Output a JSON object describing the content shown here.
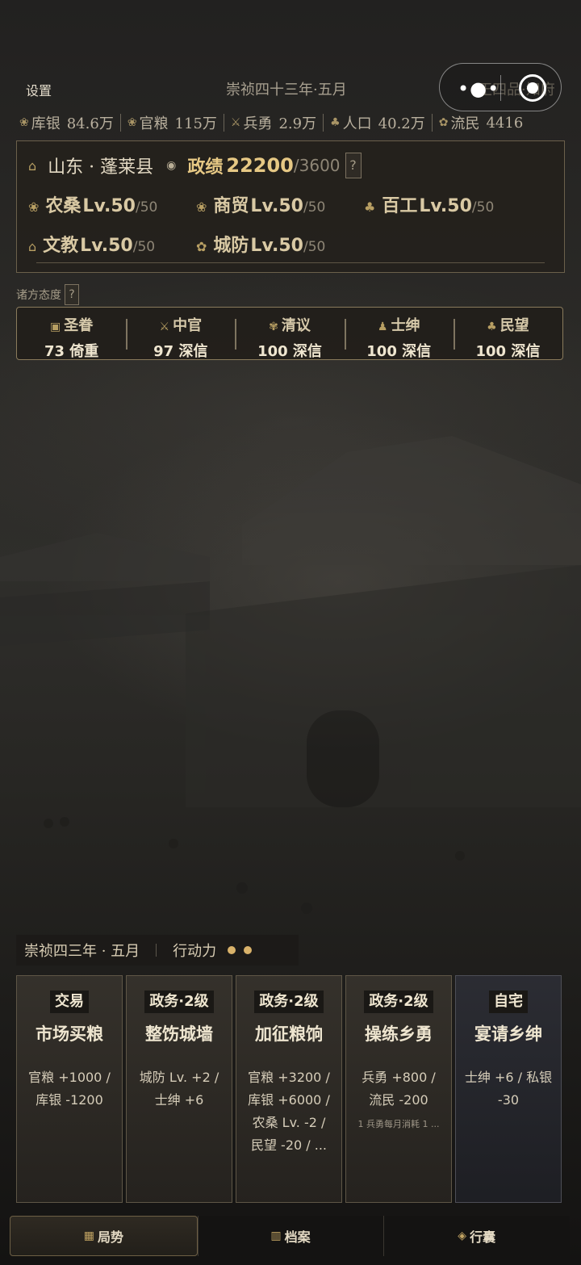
{
  "header": {
    "settings_label": "设置",
    "date": "崇祯四十三年·五月",
    "rank": "正四品·知府"
  },
  "resources": [
    {
      "icon": "silver-icon",
      "label": "库银",
      "value": "84.6万"
    },
    {
      "icon": "grain-icon",
      "label": "官粮",
      "value": "115万"
    },
    {
      "icon": "soldier-icon",
      "label": "兵勇",
      "value": "2.9万"
    },
    {
      "icon": "population-icon",
      "label": "人口",
      "value": "40.2万"
    },
    {
      "icon": "refugee-icon",
      "label": "流民",
      "value": "4416"
    }
  ],
  "region": {
    "location": "山东 · 蓬莱县",
    "performance_label": "政绩",
    "performance_value": "22200",
    "performance_max": "/3600",
    "help": "?",
    "levels": [
      {
        "name": "农桑",
        "value": "Lv.50",
        "max": "/50"
      },
      {
        "name": "商贸",
        "value": "Lv.50",
        "max": "/50"
      },
      {
        "name": "百工",
        "value": "Lv.50",
        "max": "/50"
      },
      {
        "name": "文教",
        "value": "Lv.50",
        "max": "/50"
      },
      {
        "name": "城防",
        "value": "Lv.50",
        "max": "/50"
      }
    ]
  },
  "attitudes": {
    "title": "诸方态度",
    "help": "?",
    "items": [
      {
        "name": "圣眷",
        "value": "73 倚重"
      },
      {
        "name": "中官",
        "value": "97 深信"
      },
      {
        "name": "清议",
        "value": "100 深信"
      },
      {
        "name": "士绅",
        "value": "100 深信"
      },
      {
        "name": "民望",
        "value": "100 深信"
      }
    ]
  },
  "status": {
    "date": "崇祯四三年 · 五月",
    "action_label": "行动力",
    "action_points": 2
  },
  "cards": [
    {
      "tag": "交易",
      "title": "市场买粮",
      "effects": [
        "官粮 +1000 /",
        "库银 -1200"
      ],
      "note": ""
    },
    {
      "tag": "政务·2级",
      "title": "整饬城墙",
      "effects": [
        "城防 Lv. +2 /",
        "士绅 +6"
      ],
      "note": ""
    },
    {
      "tag": "政务·2级",
      "title": "加征粮饷",
      "effects": [
        "官粮 +3200 /",
        "库银 +6000 /",
        "农桑 Lv. -2 /",
        "民望 -20 / ..."
      ],
      "note": ""
    },
    {
      "tag": "政务·2级",
      "title": "操练乡勇",
      "effects": [
        "兵勇 +800 /",
        "流民 -200"
      ],
      "note": "1 兵勇每月消耗 1 ..."
    },
    {
      "tag": "自宅",
      "title": "宴请乡绅",
      "effects": [
        "士绅 +6 / 私银",
        "-30"
      ],
      "note": ""
    }
  ],
  "nav": [
    {
      "label": "局势",
      "icon": "situation-icon",
      "active": true
    },
    {
      "label": "档案",
      "icon": "archive-icon",
      "active": false
    },
    {
      "label": "行囊",
      "icon": "bag-icon",
      "active": false
    }
  ],
  "colors": {
    "accent_gold": "#e6c884",
    "pip": "#d9b26a",
    "panel_border": "#8a7b5c"
  }
}
